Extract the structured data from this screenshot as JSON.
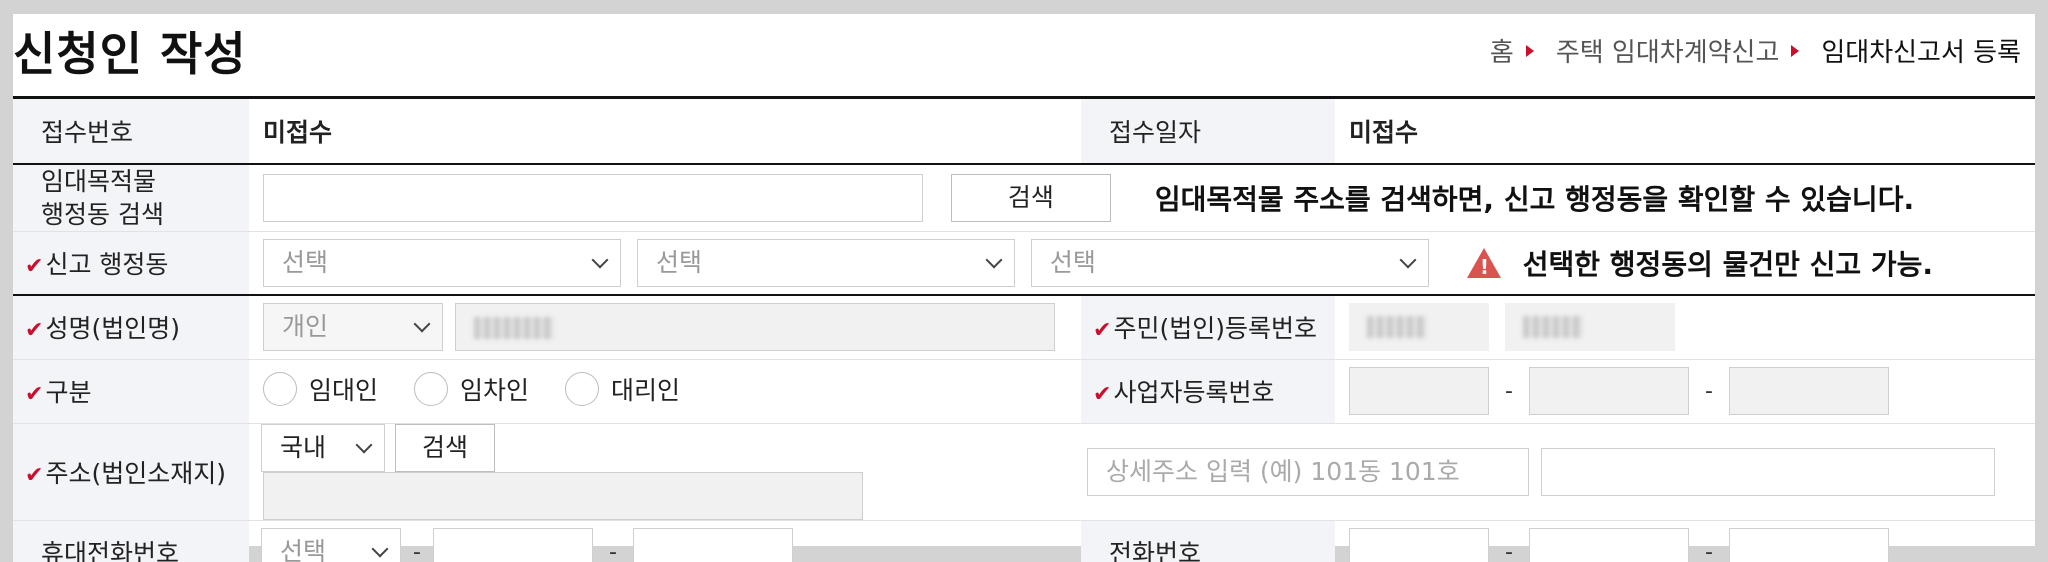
{
  "header": {
    "title": "신청인 작성",
    "breadcrumb": [
      "홈",
      "주택 임대차계약신고",
      "임대차신고서 등록"
    ]
  },
  "receipt": {
    "number_label": "접수번호",
    "number_value": "미접수",
    "date_label": "접수일자",
    "date_value": "미접수"
  },
  "property_search": {
    "label_line1": "임대목적물",
    "label_line2": "행정동 검색",
    "input_value": "",
    "search_button": "검색",
    "notice": "임대목적물 주소를 검색하면, 신고 행정동을 확인할 수 있습니다."
  },
  "report_region": {
    "label": "신고 행정동",
    "select1": "선택",
    "select2": "선택",
    "select3": "선택",
    "warning_icon": "warning-triangle-icon",
    "warning": "선택한 행정동의 물건만 신고 가능."
  },
  "name_row": {
    "label": "성명(법인명)",
    "type_select": "개인",
    "reg_label": "주민(법인)등록번호"
  },
  "type_row": {
    "label": "구분",
    "options": [
      "임대인",
      "임차인",
      "대리인"
    ],
    "biz_label": "사업자등록번호"
  },
  "address_row": {
    "label": "주소(법인소재지)",
    "country_select": "국내",
    "search_button": "검색",
    "detail_placeholder": "상세주소 입력 (예) 101동 101호"
  },
  "phone_row": {
    "mobile_label": "휴대전화번호",
    "mobile_select": "선택",
    "tel_label": "전화번호"
  },
  "colors": {
    "required_mark": "#c8102e",
    "warning": "#d9534f",
    "label_bg": "#f3f4f8"
  }
}
